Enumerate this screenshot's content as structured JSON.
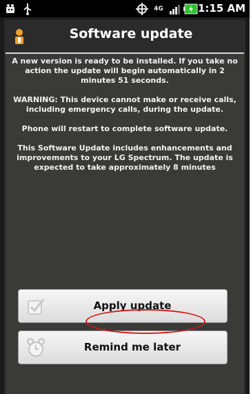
{
  "status_bar": {
    "time": "1:15 AM",
    "icons": [
      "notification-android-icon",
      "usb-icon",
      "gps-icon",
      "4g-icon",
      "signal-icon",
      "battery-icon"
    ],
    "network_label": "4G"
  },
  "dialog": {
    "title": "Software update",
    "paragraphs": [
      "A new version is ready to be installed. If you take no action the update will  begin automatically in 2 minutes 51 seconds.",
      "WARNING: This device cannot make or receive calls, including emergency calls, during the update.",
      "Phone will restart to complete software update.",
      "This Software Update includes enhancements and improvements to your LG Spectrum. The update is expected to take approximately 8 minutes"
    ],
    "buttons": {
      "apply_label": "Apply update",
      "remind_label": "Remind me later"
    }
  },
  "colors": {
    "dialog_background": "#3a3a39",
    "highlight_circle": "#d01a1a",
    "battery": "#2fc42f"
  }
}
